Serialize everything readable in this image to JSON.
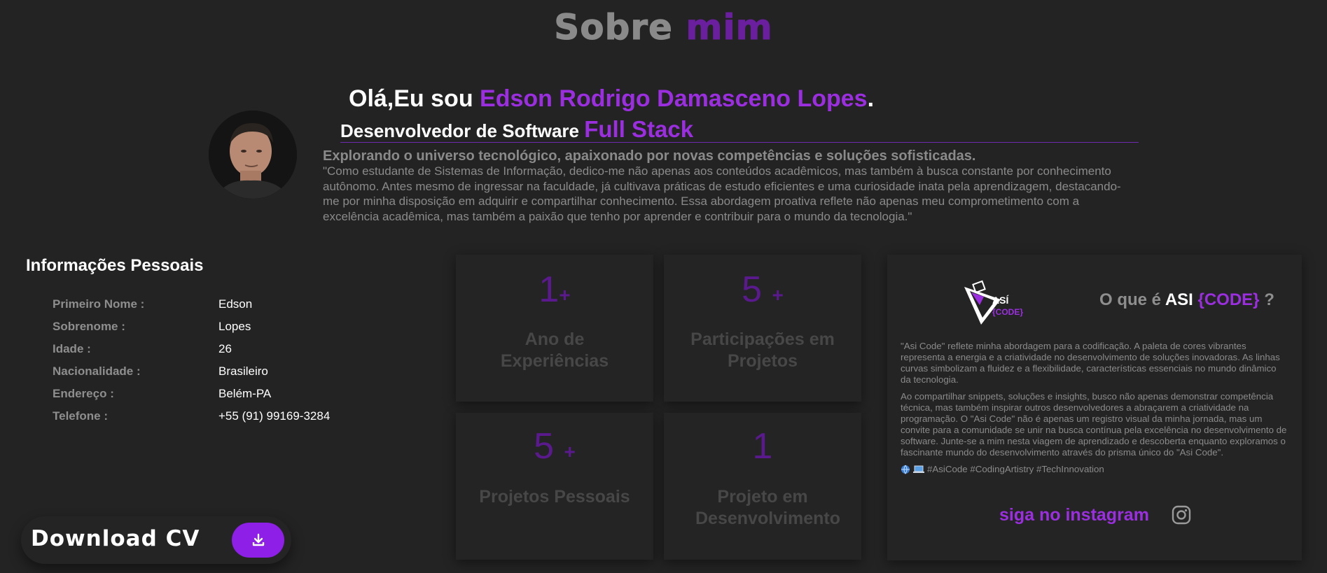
{
  "section_title": {
    "part1": "Sobre",
    "part2": "mim"
  },
  "intro": {
    "greeting_prefix": "Olá,Eu sou",
    "name": "Edson Rodrigo Damasceno Lopes",
    "greeting_suffix": ".",
    "role_prefix": "Desenvolvedor de Software",
    "role_highlight": "Full Stack",
    "tagline": "Explorando o universo tecnológico, apaixonado por novas competências e soluções sofisticadas.",
    "quote": "\"Como estudante de Sistemas de Informação, dedico-me não apenas aos conteúdos acadêmicos, mas também à busca constante por conhecimento autônomo. Antes mesmo de ingressar na faculdade, já cultivava práticas de estudo eficientes e uma curiosidade inata pela aprendizagem, destacando-me por minha disposição em adquirir e compartilhar conhecimento. Essa abordagem proativa reflete não apenas meu comprometimento com a excelência acadêmica, mas também a paixão que tenho por aprender e contribuir para o mundo da tecnologia.\""
  },
  "personal_info": {
    "title": "Informações Pessoais",
    "rows": [
      {
        "label": "Primeiro Nome :",
        "value": "Edson"
      },
      {
        "label": "Sobrenome :",
        "value": "Lopes"
      },
      {
        "label": "Idade :",
        "value": "26"
      },
      {
        "label": "Nacionalidade :",
        "value": "Brasileiro"
      },
      {
        "label": "Endereço :",
        "value": "Belém-PA"
      },
      {
        "label": "Telefone :",
        "value": "+55 (91) 99169-3284"
      }
    ]
  },
  "download": {
    "label": "Download CV",
    "icon": "download-icon"
  },
  "stats": [
    {
      "number": "1",
      "suffix": "+",
      "label": "Ano de Experiências"
    },
    {
      "number": "5 ",
      "suffix": "+",
      "label": "Participações em Projetos"
    },
    {
      "number": "5 ",
      "suffix": "+",
      "label": "Projetos Pessoais"
    },
    {
      "number": "1",
      "suffix": "",
      "label": "Projeto em Desenvolvimento"
    }
  ],
  "asi": {
    "logo_text_1": "ASÍ",
    "logo_text_2": "{CODE}",
    "heading_prefix": "O que é",
    "heading_asi": "ASI",
    "heading_code": "{CODE}",
    "heading_suffix": "?",
    "paragraph_1": "\"Asi Code\" reflete minha abordagem para a codificação. A paleta de cores vibrantes representa a energia e a criatividade no desenvolvimento de soluções inovadoras. As linhas curvas simbolizam a fluidez e a flexibilidade, características essenciais no mundo dinâmico da tecnologia.",
    "paragraph_2": "Ao compartilhar snippets, soluções e insights, busco não apenas demonstrar competência técnica, mas também inspirar outros desenvolvedores a abraçarem a criatividade na programação. O \"Asi Code\" não é apenas um registro visual da minha jornada, mas um convite para a comunidade se unir na busca contínua pela excelência no desenvolvimento de software. Junte-se a mim nesta viagem de aprendizado e descoberta enquanto exploramos o fascinante mundo do desenvolvimento através do prisma único do \"Asi Code\".",
    "hashtags": "#AsiCode #CodingArtistry #TechInnovation",
    "instagram_label": "siga no instagram",
    "instagram_icon": "instagram-icon"
  },
  "colors": {
    "accent": "#9b2fe0",
    "background": "#232323",
    "muted": "#8a8a8a"
  }
}
